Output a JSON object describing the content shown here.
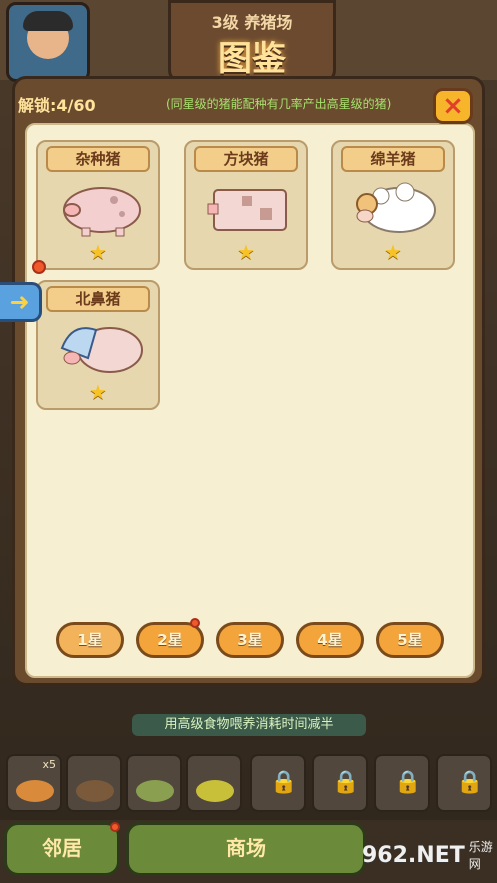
{
  "header": {
    "level": "3级  养猪场",
    "title": "图鉴"
  },
  "panel": {
    "unlock_text": "解锁:4/60",
    "hint_text": "(同星级的猪能配种有几率产出高星级的猪)",
    "close_label": "×"
  },
  "cards": [
    {
      "name": "杂种猪",
      "star": "★"
    },
    {
      "name": "方块猪",
      "star": "★"
    },
    {
      "name": "绵羊猪",
      "star": "★"
    },
    {
      "name": "北鼻猪",
      "star": "★"
    }
  ],
  "star_tabs": [
    "1星",
    "2星",
    "3星",
    "4星",
    "5星"
  ],
  "tip": "用高级食物喂养消耗时间减半",
  "inventory": {
    "first_count": "x5"
  },
  "bottom_buttons": {
    "neighbor": "邻居",
    "shop": "商场"
  },
  "watermark": {
    "main": "962.NET",
    "sub": "乐游网"
  },
  "colors": {
    "accent": "#f3a43a",
    "panel_bg": "#f6efd2"
  }
}
